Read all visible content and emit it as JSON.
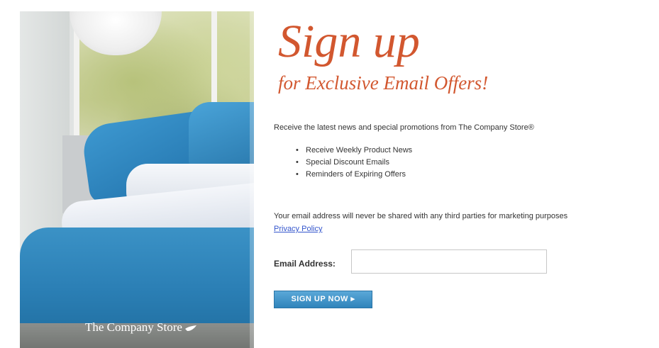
{
  "brand": {
    "name": "The Company Store"
  },
  "headline": "Sign up",
  "subheadline": "for Exclusive Email Offers!",
  "intro": "Receive the latest news and special promotions from The Company Store®",
  "benefits": [
    "Receive Weekly Product News",
    "Special Discount Emails",
    "Reminders of Expiring Offers"
  ],
  "privacy": {
    "note": "Your email address will never be shared with any third parties for marketing purposes",
    "link_label": "Privacy Policy"
  },
  "form": {
    "email_label": "Email Address:",
    "email_value": "",
    "submit_label": "SIGN UP NOW ▸"
  },
  "colors": {
    "accent": "#d2572f",
    "button": "#3a8fc6",
    "link": "#3355cc"
  }
}
